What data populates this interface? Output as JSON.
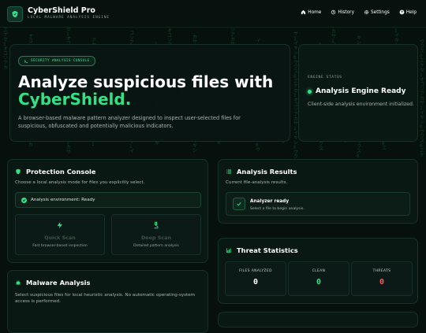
{
  "header": {
    "title": "CyberShield Pro",
    "subtitle": "LOCAL MALWARE ANALYSIS ENGINE",
    "nav": [
      {
        "label": "Home",
        "icon": "home-icon"
      },
      {
        "label": "History",
        "icon": "history-icon"
      },
      {
        "label": "Settings",
        "icon": "gear-icon"
      },
      {
        "label": "Help",
        "icon": "help-icon"
      }
    ]
  },
  "hero": {
    "badge": "SECURITY ANALYSIS CONSOLE",
    "title_line1": "Analyze suspicious files with",
    "title_accent": "CyberShield.",
    "description": "A browser-based malware pattern analyzer designed to inspect user-selected files for suspicious, obfuscated and potentially malicious indicators."
  },
  "engine_status": {
    "label": "ENGINE STATUS",
    "status": "Analysis Engine Ready",
    "detail": "Client-side analysis environment initialized."
  },
  "protection": {
    "title": "Protection Console",
    "description": "Choose a local analysis mode for files you explicitly select.",
    "env_status": "Analysis environment: Ready",
    "modes": [
      {
        "title": "Quick Scan",
        "desc": "Fast browser-based inspection"
      },
      {
        "title": "Deep Scan",
        "desc": "Detailed pattern analysis"
      }
    ]
  },
  "malware": {
    "title": "Malware Analysis",
    "description": "Select suspicious files for local heuristic analysis. No automatic operating-system access is performed."
  },
  "results": {
    "title": "Analysis Results",
    "description": "Current file-analysis results.",
    "ready_title": "Analyzer ready",
    "ready_sub": "Select a file to begin analysis."
  },
  "stats": {
    "title": "Threat Statistics",
    "items": [
      {
        "label": "FILES ANALYZED",
        "value": "0",
        "color": "#ffffff"
      },
      {
        "label": "CLEAN",
        "value": "0",
        "color": "#33e086"
      },
      {
        "label": "THREATS",
        "value": "0",
        "color": "#ff5a5a"
      }
    ]
  },
  "colors": {
    "accent": "#33e086",
    "danger": "#ff5a5a",
    "background": "#06100d"
  }
}
